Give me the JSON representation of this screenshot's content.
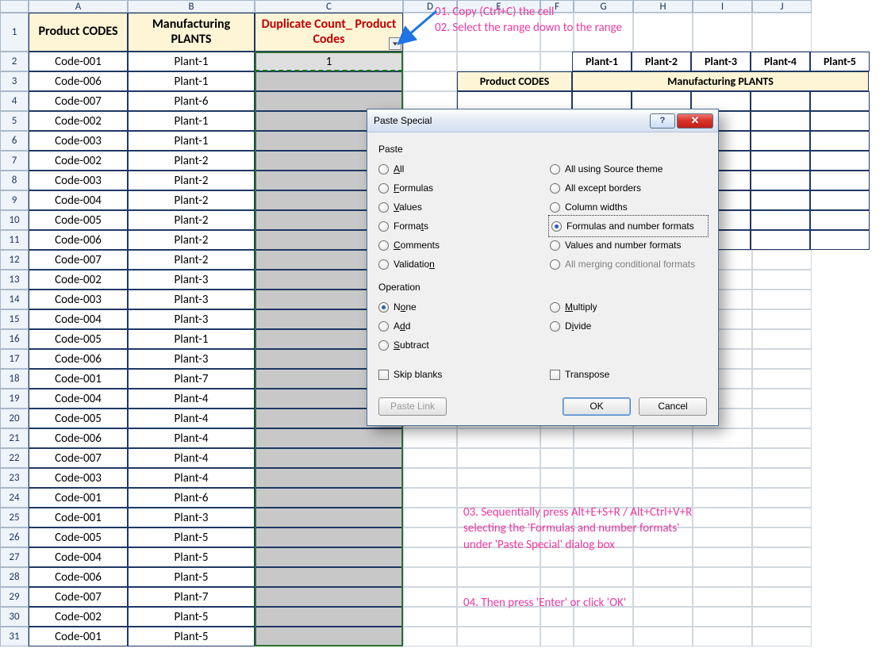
{
  "columns": [
    "A",
    "B",
    "C",
    "D",
    "E",
    "F",
    "G",
    "H",
    "I",
    "J"
  ],
  "headers": {
    "A": "Product CODES",
    "B": "Manufacturing PLANTS",
    "C": "Duplicate Count_ Product Codes"
  },
  "row1_c_value": "1",
  "rows": [
    {
      "n": 2,
      "A": "Code-001",
      "B": "Plant-1"
    },
    {
      "n": 3,
      "A": "Code-006",
      "B": "Plant-1"
    },
    {
      "n": 4,
      "A": "Code-007",
      "B": "Plant-6"
    },
    {
      "n": 5,
      "A": "Code-002",
      "B": "Plant-1"
    },
    {
      "n": 6,
      "A": "Code-003",
      "B": "Plant-1"
    },
    {
      "n": 7,
      "A": "Code-002",
      "B": "Plant-2"
    },
    {
      "n": 8,
      "A": "Code-003",
      "B": "Plant-2"
    },
    {
      "n": 9,
      "A": "Code-004",
      "B": "Plant-2"
    },
    {
      "n": 10,
      "A": "Code-005",
      "B": "Plant-2"
    },
    {
      "n": 11,
      "A": "Code-006",
      "B": "Plant-2"
    },
    {
      "n": 12,
      "A": "Code-007",
      "B": "Plant-2"
    },
    {
      "n": 13,
      "A": "Code-002",
      "B": "Plant-3"
    },
    {
      "n": 14,
      "A": "Code-003",
      "B": "Plant-3"
    },
    {
      "n": 15,
      "A": "Code-004",
      "B": "Plant-3"
    },
    {
      "n": 16,
      "A": "Code-005",
      "B": "Plant-1"
    },
    {
      "n": 17,
      "A": "Code-006",
      "B": "Plant-3"
    },
    {
      "n": 18,
      "A": "Code-001",
      "B": "Plant-7"
    },
    {
      "n": 19,
      "A": "Code-004",
      "B": "Plant-4"
    },
    {
      "n": 20,
      "A": "Code-005",
      "B": "Plant-4"
    },
    {
      "n": 21,
      "A": "Code-006",
      "B": "Plant-4"
    },
    {
      "n": 22,
      "A": "Code-007",
      "B": "Plant-4"
    },
    {
      "n": 23,
      "A": "Code-003",
      "B": "Plant-4"
    },
    {
      "n": 24,
      "A": "Code-001",
      "B": "Plant-6"
    },
    {
      "n": 25,
      "A": "Code-001",
      "B": "Plant-3"
    },
    {
      "n": 26,
      "A": "Code-005",
      "B": "Plant-5"
    },
    {
      "n": 27,
      "A": "Code-004",
      "B": "Plant-5"
    },
    {
      "n": 28,
      "A": "Code-006",
      "B": "Plant-5"
    },
    {
      "n": 29,
      "A": "Code-007",
      "B": "Plant-7"
    },
    {
      "n": 30,
      "A": "Code-002",
      "B": "Plant-5"
    },
    {
      "n": 31,
      "A": "Code-001",
      "B": "Plant-5"
    }
  ],
  "side_table": {
    "row_header": "Product CODES",
    "col_headers": [
      "Plant-1",
      "Plant-2",
      "Plant-3",
      "Plant-4",
      "Plant-5"
    ],
    "title_right": "Manufacturing PLANTS"
  },
  "annotations": {
    "a1": "01. Copy (Ctrl+C) the cell\n02. Select the range down to the range",
    "a2": "03. Sequentially press Alt+E+S+R / Alt+Ctrl+V+R\nselecting the 'Formulas and number formats'\nunder 'Paste Special' dialog box",
    "a3": "04. Then press 'Enter' or click 'OK'"
  },
  "dialog": {
    "title": "Paste Special",
    "paste_label": "Paste",
    "operation_label": "Operation",
    "paste_left": [
      {
        "label": "All",
        "u": "A"
      },
      {
        "label": "Formulas",
        "u": "F"
      },
      {
        "label": "Values",
        "u": "V"
      },
      {
        "label": "Formats",
        "u": "t",
        "full": "Formats"
      },
      {
        "label": "Comments",
        "u": "C"
      },
      {
        "label": "Validation",
        "u": "n",
        "full": "Validation"
      }
    ],
    "paste_right": [
      {
        "label": "All using Source theme"
      },
      {
        "label": "All except borders"
      },
      {
        "label": "Column widths"
      },
      {
        "label": "Formulas and number formats",
        "checked": true,
        "focus": true
      },
      {
        "label": "Values and number formats"
      },
      {
        "label": "All merging conditional formats",
        "disabled": true
      }
    ],
    "op_left": [
      {
        "label": "None",
        "checked": true,
        "u": "o",
        "full": "None"
      },
      {
        "label": "Add",
        "u": "d",
        "full": "Add"
      },
      {
        "label": "Subtract",
        "u": "S"
      }
    ],
    "op_right": [
      {
        "label": "Multiply",
        "u": "M"
      },
      {
        "label": "Divide",
        "u": "i",
        "full": "Divide"
      }
    ],
    "skip_blanks": "Skip blanks",
    "transpose": "Transpose",
    "paste_link": "Paste Link",
    "ok": "OK",
    "cancel": "Cancel"
  }
}
